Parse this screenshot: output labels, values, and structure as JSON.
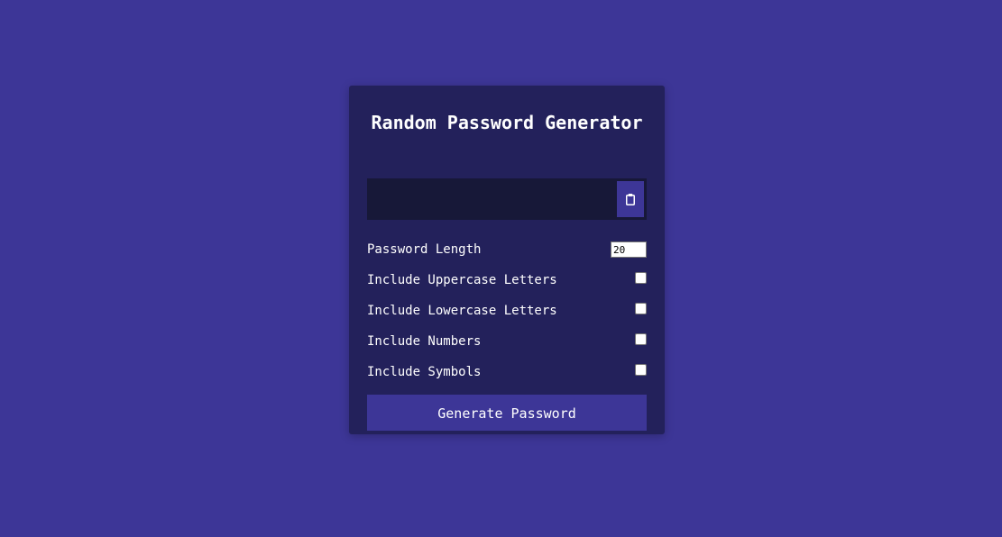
{
  "colors": {
    "page_background": "#3d3697",
    "card_background": "#23215b",
    "result_background": "#171838",
    "button_background": "#3d3697"
  },
  "card": {
    "title": "Random Password Generator"
  },
  "result": {
    "value": "",
    "clipboard_icon": "clipboard-icon"
  },
  "settings": {
    "length": {
      "label": "Password Length",
      "value": "20"
    },
    "uppercase": {
      "label": "Include Uppercase Letters",
      "checked": false
    },
    "lowercase": {
      "label": "Include Lowercase Letters",
      "checked": false
    },
    "numbers": {
      "label": "Include Numbers",
      "checked": false
    },
    "symbols": {
      "label": "Include Symbols",
      "checked": false
    }
  },
  "generate_button": {
    "label": "Generate Password"
  }
}
